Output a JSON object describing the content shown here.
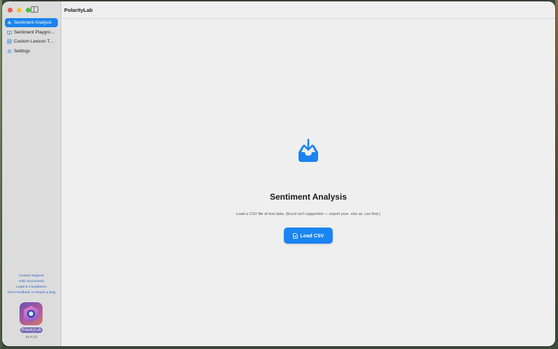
{
  "app": {
    "title": "PolarityLab",
    "brand": "PolarityLab",
    "version": "v1.0 (1)"
  },
  "sidebar": {
    "items": [
      {
        "label": "Sentiment Analysis",
        "icon": "waveform-icon",
        "active": true
      },
      {
        "label": "Sentiment Playground",
        "icon": "book-icon",
        "active": false
      },
      {
        "label": "Custom Lexicon Temp...",
        "icon": "grid-icon",
        "active": false
      },
      {
        "label": "Settings",
        "icon": "gear-icon",
        "active": false
      }
    ],
    "links": [
      "Contact Support",
      "Help Documents",
      "Legal & Compliance",
      "Give Feedback or Report a Bug"
    ]
  },
  "main": {
    "empty_state": {
      "icon": "tray-download-icon",
      "title": "Sentiment Analysis",
      "subtitle": "Load a CSV file of text data. (Excel isn't supported — export your .xlsx as .csv first.)",
      "button_label": "Load CSV",
      "button_icon": "document-icon"
    }
  },
  "colors": {
    "accent": "#1a84f4",
    "sidebar_bg": "#dcdcdc",
    "content_bg": "#efefef",
    "link": "#2a62c0"
  }
}
